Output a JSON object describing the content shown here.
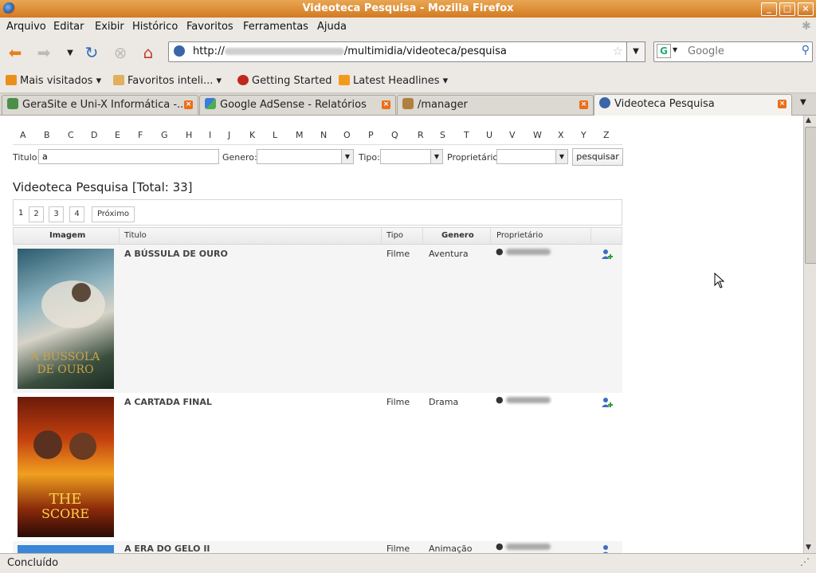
{
  "window": {
    "title": "Videoteca Pesquisa - Mozilla Firefox"
  },
  "menu": [
    "Arquivo",
    "Editar",
    "Exibir",
    "Histórico",
    "Favoritos",
    "Ferramentas",
    "Ajuda"
  ],
  "nav": {
    "url_prefix": "http://",
    "url_suffix": "/multimidia/videoteca/pesquisa",
    "search_placeholder": "Google"
  },
  "bookmarks": [
    "Mais visitados",
    "Favoritos inteli...",
    "Getting Started",
    "Latest Headlines"
  ],
  "tabs": [
    {
      "label": "GeraSite e Uni-X Informática -..."
    },
    {
      "label": "Google AdSense - Relatórios"
    },
    {
      "label": "/manager"
    },
    {
      "label": "Videoteca Pesquisa"
    }
  ],
  "page": {
    "letters": [
      "A",
      "B",
      "C",
      "D",
      "E",
      "F",
      "G",
      "H",
      "I",
      "J",
      "K",
      "L",
      "M",
      "N",
      "O",
      "P",
      "Q",
      "R",
      "S",
      "T",
      "U",
      "V",
      "W",
      "X",
      "Y",
      "Z"
    ],
    "filters": {
      "titulo_label": "Titulo:",
      "titulo_value": "a",
      "genero_label": "Genero:",
      "tipo_label": "Tipo:",
      "proprietario_label": "Proprietário:",
      "search_button": "pesquisar"
    },
    "heading": "Videoteca Pesquisa [Total: 33]",
    "pager": {
      "current": "1",
      "pages": [
        "2",
        "3",
        "4"
      ],
      "next": "Próximo"
    },
    "columns": {
      "imagem": "Imagem",
      "titulo": "Titulo",
      "tipo": "Tipo",
      "genero": "Genero",
      "proprietario": "Proprietário"
    },
    "rows": [
      {
        "titulo": "A BÚSSULA DE OURO",
        "tipo": "Filme",
        "genero": "Aventura"
      },
      {
        "titulo": "A CARTADA FINAL",
        "tipo": "Filme",
        "genero": "Drama"
      },
      {
        "titulo": "A ERA DO GELO II",
        "tipo": "Filme",
        "genero": "Animação"
      }
    ]
  },
  "status": {
    "text": "Concluído"
  },
  "colors": {
    "titlebar": "#d37a22",
    "tab_close": "#e8701a",
    "accent_link": "#444444"
  }
}
